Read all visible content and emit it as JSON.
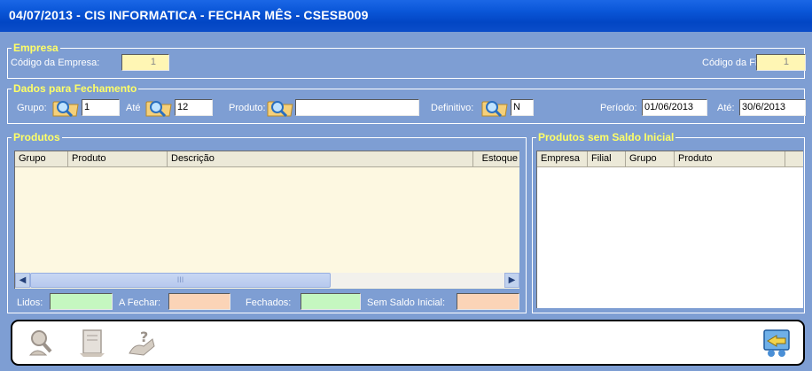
{
  "window": {
    "title": "04/07/2013  -  CIS INFORMATICA  -  FECHAR MÊS  -  CSESB009"
  },
  "empresa": {
    "legend": "Empresa",
    "codigo_empresa_label": "Código da Empresa:",
    "codigo_empresa_value": "1",
    "codigo_filial_label": "Código da Filial:",
    "codigo_filial_value": "1"
  },
  "fechamento": {
    "legend": "Dados para Fechamento",
    "grupo_label": "Grupo:",
    "grupo_value": "1",
    "ate_label": "Até",
    "ate_value": "12",
    "produto_label": "Produto:",
    "produto_value": "",
    "definitivo_label": "Definitivo:",
    "definitivo_value": "N",
    "periodo_label": "Período:",
    "periodo_value": "01/06/2013",
    "periodo_ate_label": "Até:",
    "periodo_ate_value": "30/6/2013"
  },
  "produtos": {
    "legend": "Produtos",
    "columns": [
      "Grupo",
      "Produto",
      "Descrição",
      "Estoque"
    ],
    "rows": [],
    "scroll_thumb_label": "III"
  },
  "sem_saldo": {
    "legend": "Produtos sem Saldo Inicial",
    "columns": [
      "Empresa",
      "Filial",
      "Grupo",
      "Produto"
    ],
    "rows": []
  },
  "totais": {
    "lidos_label": "Lidos:",
    "lidos_value": "",
    "a_fechar_label": "A Fechar:",
    "a_fechar_value": "",
    "fechados_label": "Fechados:",
    "fechados_value": "",
    "sem_saldo_label": "Sem Saldo Inicial:",
    "sem_saldo_value": ""
  },
  "toolbar": {
    "buttons": [
      {
        "icon": "search-person-icon",
        "state": "disabled"
      },
      {
        "icon": "save-document-icon",
        "state": "disabled"
      },
      {
        "icon": "help-icon",
        "state": "disabled"
      },
      {
        "icon": "exit-icon",
        "state": "enabled"
      }
    ]
  },
  "colors": {
    "window_bg": "#7e9ed3",
    "titlebar": "#0a56d8",
    "legend_text": "#ffff66",
    "grid_produtos_bg": "#fdf8e1",
    "field_yellow": "#fff6b4",
    "field_green": "#c5f7c0",
    "field_peach": "#fbd4b7"
  }
}
